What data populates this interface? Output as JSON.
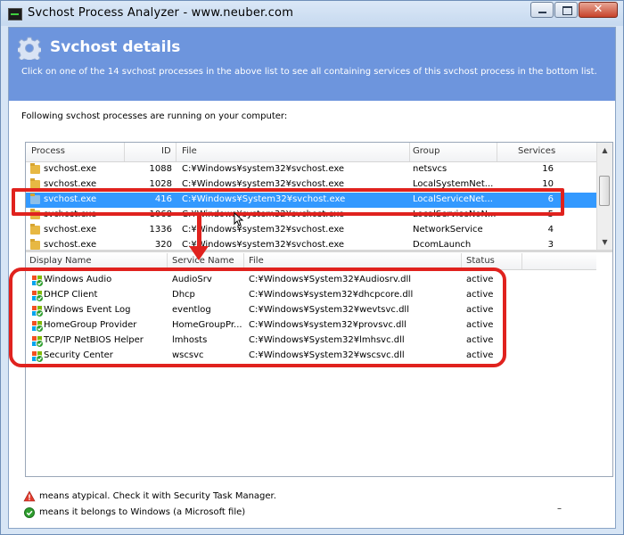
{
  "window": {
    "title": "Svchost Process Analyzer - www.neuber.com"
  },
  "header": {
    "title": "Svchost details",
    "subtitle": "Click on one of the 14 svchost processes in the above list to see all containing services of this svchost process in the bottom list."
  },
  "intro": "Following svchost processes are running on your computer:",
  "process_table": {
    "columns": [
      "Process",
      "ID",
      "File",
      "Group",
      "Services"
    ],
    "rows": [
      {
        "process": "svchost.exe",
        "id": "1088",
        "file": "C:¥Windows¥system32¥svchost.exe",
        "group": "netsvcs",
        "services": "16"
      },
      {
        "process": "svchost.exe",
        "id": "1028",
        "file": "C:¥Windows¥system32¥svchost.exe",
        "group": "LocalSystemNet...",
        "services": "10"
      },
      {
        "process": "svchost.exe",
        "id": "416",
        "file": "C:¥Windows¥System32¥svchost.exe",
        "group": "LocalServiceNet...",
        "services": "6"
      },
      {
        "process": "svchost.exe",
        "id": "1068",
        "file": "C:¥Windows¥system32¥svchost.exe",
        "group": "LocalServiceNoN...",
        "services": "5"
      },
      {
        "process": "svchost.exe",
        "id": "1336",
        "file": "C:¥Windows¥system32¥svchost.exe",
        "group": "NetworkService",
        "services": "4"
      },
      {
        "process": "svchost.exe",
        "id": "320",
        "file": "C:¥Windows¥system32¥svchost.exe",
        "group": "DcomLaunch",
        "services": "3"
      }
    ],
    "selected_index": 2
  },
  "service_table": {
    "columns": [
      "Display Name",
      "Service Name",
      "File",
      "Status"
    ],
    "rows": [
      {
        "display": "Windows Audio",
        "service": "AudioSrv",
        "file": "C:¥Windows¥System32¥Audiosrv.dll",
        "status": "active"
      },
      {
        "display": "DHCP Client",
        "service": "Dhcp",
        "file": "C:¥Windows¥system32¥dhcpcore.dll",
        "status": "active"
      },
      {
        "display": "Windows Event Log",
        "service": "eventlog",
        "file": "C:¥Windows¥System32¥wevtsvc.dll",
        "status": "active"
      },
      {
        "display": "HomeGroup Provider",
        "service": "HomeGroupPr...",
        "file": "C:¥Windows¥system32¥provsvc.dll",
        "status": "active"
      },
      {
        "display": "TCP/IP NetBIOS Helper",
        "service": "lmhosts",
        "file": "C:¥Windows¥System32¥lmhsvc.dll",
        "status": "active"
      },
      {
        "display": "Security Center",
        "service": "wscsvc",
        "file": "C:¥Windows¥System32¥wscsvc.dll",
        "status": "active"
      }
    ]
  },
  "legend": {
    "warning_text": "means atypical. Check it with Security Task Manager.",
    "ok_text": "means it belongs to Windows (a Microsoft file)"
  },
  "footer_dash": "–",
  "colors": {
    "header_band": "#6d95dd",
    "selection": "#3399ff",
    "annotation_red": "#e0221e"
  }
}
